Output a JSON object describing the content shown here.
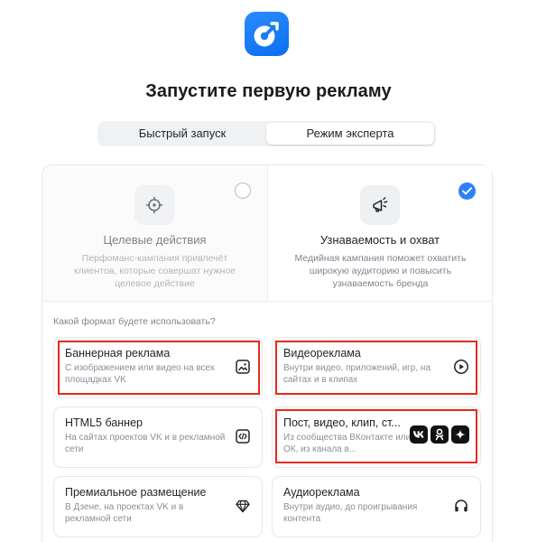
{
  "logo": {
    "name": "app-logo"
  },
  "title": "Запустите первую рекламу",
  "mode_switch": {
    "options": [
      "Быстрый запуск",
      "Режим эксперта"
    ],
    "selected": "Режим эксперта"
  },
  "goals": [
    {
      "title": "Целевые действия",
      "description": "Перфоманс-кампания привлечёт клиентов, которые совершат нужное целевое действие",
      "icon": "target-crosshair-icon",
      "selected": false
    },
    {
      "title": "Узнаваемость и охват",
      "description": "Медийная кампания поможет охватить широкую аудиторию и повысить узнаваемость бренда",
      "icon": "megaphone-icon",
      "selected": true
    }
  ],
  "format_question": "Какой формат будете использовать?",
  "formats": [
    {
      "title": "Баннерная реклама",
      "description": "С изображением или видео на всех площадках VK",
      "icon": "image-icon",
      "highlighted": true
    },
    {
      "title": "Видеореклама",
      "description": "Внутри видео, приложений, игр, на сайтах и в клипах",
      "icon": "play-circle-icon",
      "highlighted": true
    },
    {
      "title": "HTML5 баннер",
      "description": "На сайтах проектов VK и в рекламной сети",
      "icon": "code-icon",
      "highlighted": false
    },
    {
      "title": "Пост, видео, клип, ст...",
      "description": "Из сообщества ВКонтакте или ОК, из канала в...",
      "icons": [
        "vk-icon",
        "ok-icon",
        "sparkle-icon"
      ],
      "highlighted": true
    },
    {
      "title": "Премиальное размещение",
      "description": "В Дзене, на проектах VK и в рекламной сети",
      "icon": "diamond-icon",
      "highlighted": false
    },
    {
      "title": "Аудиореклама",
      "description": "Внутри аудио, до проигрывания контента",
      "icon": "headphones-icon",
      "highlighted": false
    }
  ],
  "colors": {
    "accent": "#2d81f7",
    "highlight": "#e8291c",
    "text": "#1f2329",
    "muted": "#8a8f96"
  }
}
